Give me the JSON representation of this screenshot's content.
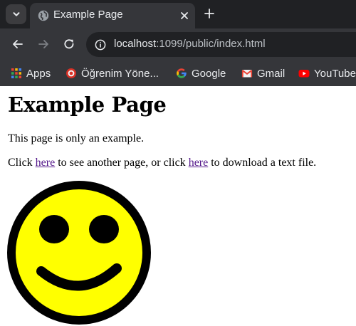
{
  "browser": {
    "tab_title": "Example Page",
    "url_host": "localhost",
    "url_rest": ":1099/public/index.html",
    "bookmarks": [
      {
        "label": "Apps",
        "icon": "apps-grid-icon"
      },
      {
        "label": "Öğrenim Yöne...",
        "icon": "target-icon"
      },
      {
        "label": "Google",
        "icon": "google-icon"
      },
      {
        "label": "Gmail",
        "icon": "gmail-icon"
      },
      {
        "label": "YouTube",
        "icon": "youtube-icon"
      }
    ]
  },
  "page": {
    "heading": "Example Page",
    "intro": "This page is only an example.",
    "line2_part1": "Click ",
    "link1": "here",
    "line2_part2": " to see another page, or click ",
    "link2": "here",
    "line2_part3": " to download a text file."
  },
  "colors": {
    "chrome_dark": "#202124",
    "chrome_toolbar": "#35363a",
    "link_visited": "#551a8b",
    "smiley_face": "#ffff00"
  }
}
